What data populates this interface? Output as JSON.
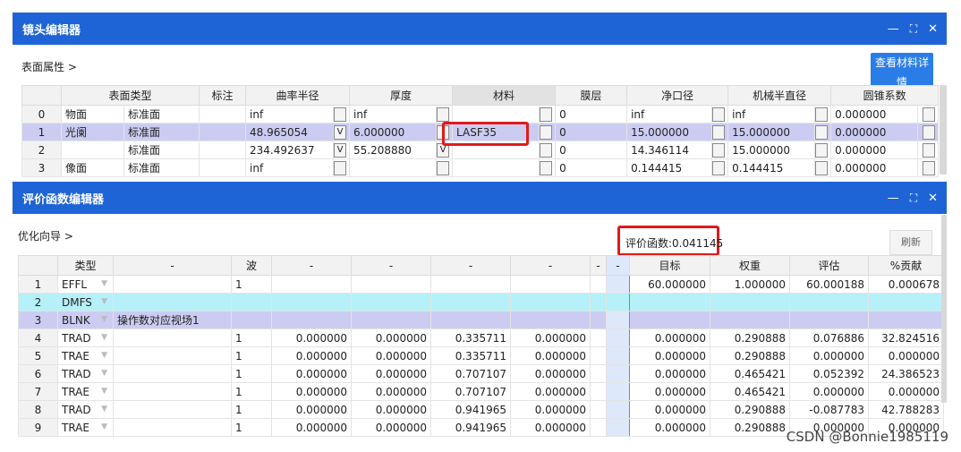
{
  "lens_editor": {
    "title": "镜头编辑器",
    "breadcrumb": "表面属性 >",
    "view_material_btn": "查看材料详情",
    "headers": [
      "",
      "表面类型",
      "",
      "标注",
      "曲率半径",
      "",
      "厚度",
      "",
      "材料",
      "",
      "膜层",
      "净口径",
      "",
      "机械半直径",
      "",
      "圆锥系数",
      ""
    ],
    "rows": [
      {
        "idx": "0",
        "name": "物面",
        "type": "标准面",
        "label": "",
        "radius": "inf",
        "rchk": "",
        "thick": "inf",
        "tchk": "",
        "mat": "",
        "coat": "0",
        "clear": "inf",
        "mech": "inf",
        "conic": "0.000000"
      },
      {
        "idx": "1",
        "name": "光阑",
        "type": "标准面",
        "label": "",
        "radius": "48.965054",
        "rchk": "V",
        "thick": "6.000000",
        "tchk": "",
        "mat": "LASF35",
        "coat": "0",
        "clear": "15.000000",
        "mech": "15.000000",
        "conic": "0.000000"
      },
      {
        "idx": "2",
        "name": "",
        "type": "标准面",
        "label": "",
        "radius": "234.492637",
        "rchk": "V",
        "thick": "55.208880",
        "tchk": "V",
        "mat": "",
        "coat": "0",
        "clear": "14.346114",
        "mech": "15.000000",
        "conic": "0.000000"
      },
      {
        "idx": "3",
        "name": "像面",
        "type": "标准面",
        "label": "",
        "radius": "inf",
        "rchk": "",
        "thick": "",
        "tchk": "",
        "mat": "",
        "coat": "0",
        "clear": "0.144415",
        "mech": "0.144415",
        "conic": "0.000000"
      }
    ]
  },
  "merit_editor": {
    "title": "评价函数编辑器",
    "breadcrumb": "优化向导 >",
    "merit_value": "评价函数:0.041145",
    "refresh_btn": "刷新",
    "headers": [
      "",
      "类型",
      "-",
      "波",
      "-",
      "-",
      "-",
      "-",
      "-",
      "-",
      "目标",
      "权重",
      "评估",
      "%贡献"
    ],
    "rows": [
      {
        "idx": "1",
        "type": "EFFL",
        "c1": "",
        "wave": "1",
        "a": "",
        "b": "",
        "c": "",
        "d": "",
        "target": "60.000000",
        "weight": "1.000000",
        "value": "60.000188",
        "contrib": "0.000678"
      },
      {
        "idx": "2",
        "type": "DMFS",
        "c1": "",
        "wave": "",
        "a": "",
        "b": "",
        "c": "",
        "d": "",
        "target": "",
        "weight": "",
        "value": "",
        "contrib": ""
      },
      {
        "idx": "3",
        "type": "BLNK",
        "c1": "操作数对应视场1",
        "wave": "",
        "a": "",
        "b": "",
        "c": "",
        "d": "",
        "target": "",
        "weight": "",
        "value": "",
        "contrib": ""
      },
      {
        "idx": "4",
        "type": "TRAD",
        "c1": "",
        "wave": "1",
        "a": "0.000000",
        "b": "0.000000",
        "c": "0.335711",
        "d": "0.000000",
        "target": "0.000000",
        "weight": "0.290888",
        "value": "0.076886",
        "contrib": "32.824516"
      },
      {
        "idx": "5",
        "type": "TRAE",
        "c1": "",
        "wave": "1",
        "a": "0.000000",
        "b": "0.000000",
        "c": "0.335711",
        "d": "0.000000",
        "target": "0.000000",
        "weight": "0.290888",
        "value": "0.000000",
        "contrib": "0.000000"
      },
      {
        "idx": "6",
        "type": "TRAD",
        "c1": "",
        "wave": "1",
        "a": "0.000000",
        "b": "0.000000",
        "c": "0.707107",
        "d": "0.000000",
        "target": "0.000000",
        "weight": "0.465421",
        "value": "0.052392",
        "contrib": "24.386523"
      },
      {
        "idx": "7",
        "type": "TRAE",
        "c1": "",
        "wave": "1",
        "a": "0.000000",
        "b": "0.000000",
        "c": "0.707107",
        "d": "0.000000",
        "target": "0.000000",
        "weight": "0.465421",
        "value": "0.000000",
        "contrib": "0.000000"
      },
      {
        "idx": "8",
        "type": "TRAD",
        "c1": "",
        "wave": "1",
        "a": "0.000000",
        "b": "0.000000",
        "c": "0.941965",
        "d": "0.000000",
        "target": "0.000000",
        "weight": "0.290888",
        "value": "-0.087783",
        "contrib": "42.788283"
      },
      {
        "idx": "9",
        "type": "TRAE",
        "c1": "",
        "wave": "1",
        "a": "0.000000",
        "b": "0.000000",
        "c": "0.941965",
        "d": "0.000000",
        "target": "0.000000",
        "weight": "0.290888",
        "value": "0.000000",
        "contrib": "0.000000"
      }
    ]
  },
  "window_controls": {
    "minimize": "—",
    "maximize": "⛶",
    "close": "✕"
  },
  "watermark": "CSDN @Bonnie1985119",
  "colors": {
    "title_bar": "#1e64d6",
    "selected_row": "#ccccf2",
    "cyan_row": "#b6f0f8",
    "highlight": "#e21a1a"
  }
}
